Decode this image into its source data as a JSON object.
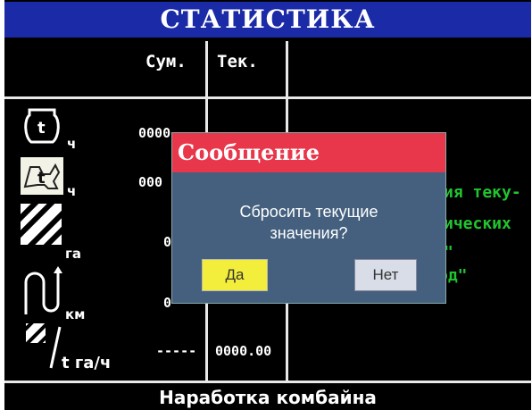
{
  "title": "СТАТИСТИКА",
  "columns": {
    "sum": "Сум.",
    "cur": "Тек."
  },
  "rows": [
    {
      "icon": "engine-hours-icon",
      "unit": "ч",
      "sum": "0000",
      "cur": ""
    },
    {
      "icon": "threshing-hours-icon",
      "unit": "ч",
      "sum": "000",
      "cur": ""
    },
    {
      "icon": "area-icon",
      "unit": "га",
      "sum": "0",
      "cur": ""
    },
    {
      "icon": "distance-icon",
      "unit": "км",
      "sum": "0",
      "cur": ""
    },
    {
      "icon": "productivity-icon",
      "unit": "t га/ч",
      "sum": "-----",
      "cur": "0000.00"
    }
  ],
  "side_text": [
    "ия теку-",
    "ических",
    "\"",
    "од\""
  ],
  "footer": "Наработка комбайна",
  "dialog": {
    "title": "Сообщение",
    "message_line1": "Сбросить текущие",
    "message_line2": "значения?",
    "yes_label": "Да",
    "no_label": "Нет"
  }
}
